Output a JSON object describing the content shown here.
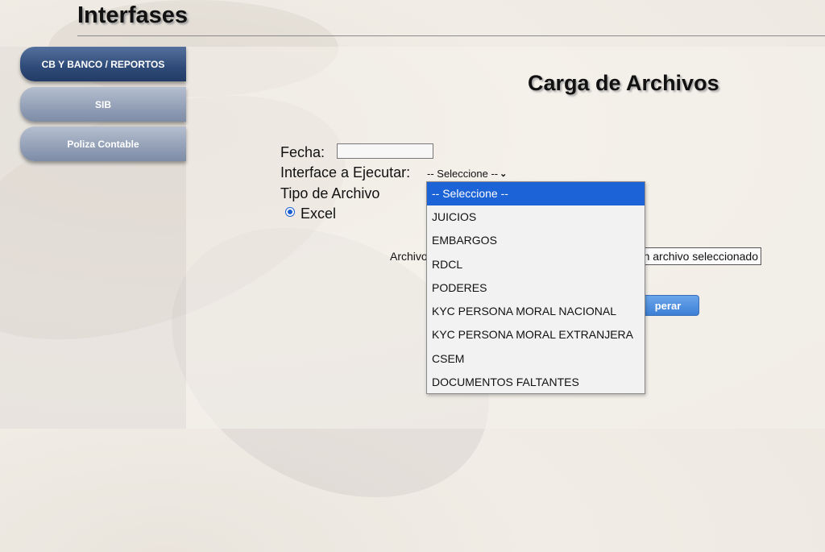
{
  "header": {
    "title": "Interfases"
  },
  "sidebar": {
    "items": [
      {
        "label": "CB Y BANCO / REPORTOS",
        "active": true
      },
      {
        "label": "SIB",
        "active": false
      },
      {
        "label": "Poliza Contable",
        "active": false
      }
    ]
  },
  "main": {
    "title": "Carga de Archivos",
    "fecha_label": "Fecha:",
    "fecha_value": "",
    "interface_label": "Interface a Ejecutar:",
    "interface_selected": "-- Seleccione --",
    "tipo_label": "Tipo de Archivo",
    "tipo_option": "Excel",
    "archivo_label": "Archivo",
    "file_status": "n archivo seleccionado",
    "process_button": "perar",
    "dropdown_options": [
      "-- Seleccione --",
      "JUICIOS",
      "EMBARGOS",
      "RDCL",
      "PODERES",
      "KYC PERSONA MORAL NACIONAL",
      "KYC PERSONA MORAL EXTRANJERA",
      "CSEM",
      "DOCUMENTOS FALTANTES"
    ]
  },
  "colors": {
    "accent": "#1b63d6",
    "sidebar_active": "#2e4a78",
    "sidebar_inactive": "#8d9ab2"
  }
}
